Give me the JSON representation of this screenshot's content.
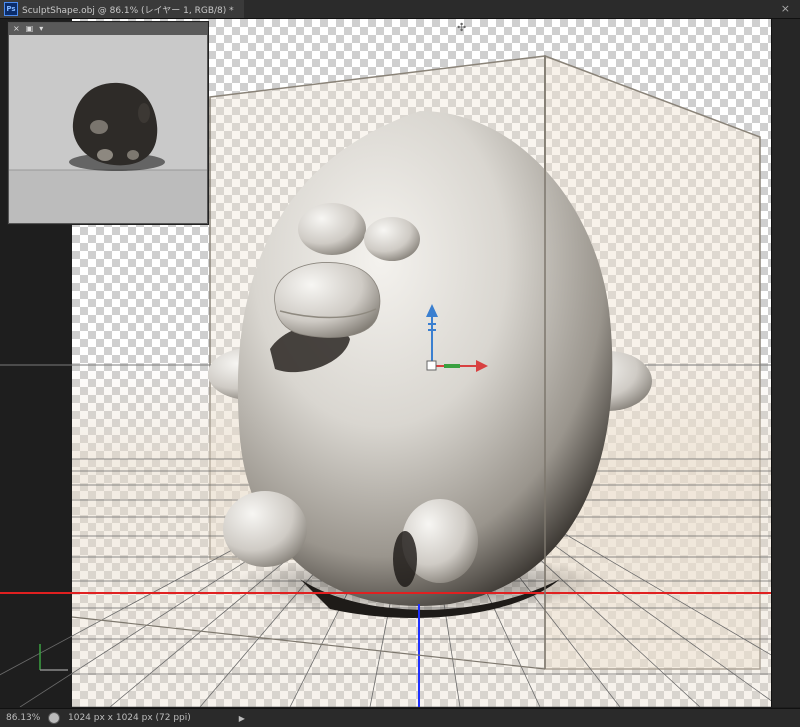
{
  "document": {
    "tab_title": "SculptShape.obj @ 86.1% (レイヤー 1, RGB/8) *",
    "app_icon_label": "Ps",
    "close_glyph": "×"
  },
  "mini_panel": {
    "buttons": [
      "×",
      "▣",
      "▾"
    ]
  },
  "status_bar": {
    "zoom": "86.13%",
    "doc_info": "1024 px x 1024 px (72 ppi)",
    "arrow": "▶"
  },
  "colors": {
    "ground_line_red": "#e02020",
    "axis_blue": "#1e2fff",
    "gizmo_y": "#3a7fd0",
    "gizmo_x": "#d84040",
    "gizmo_z": "#3aa040"
  }
}
